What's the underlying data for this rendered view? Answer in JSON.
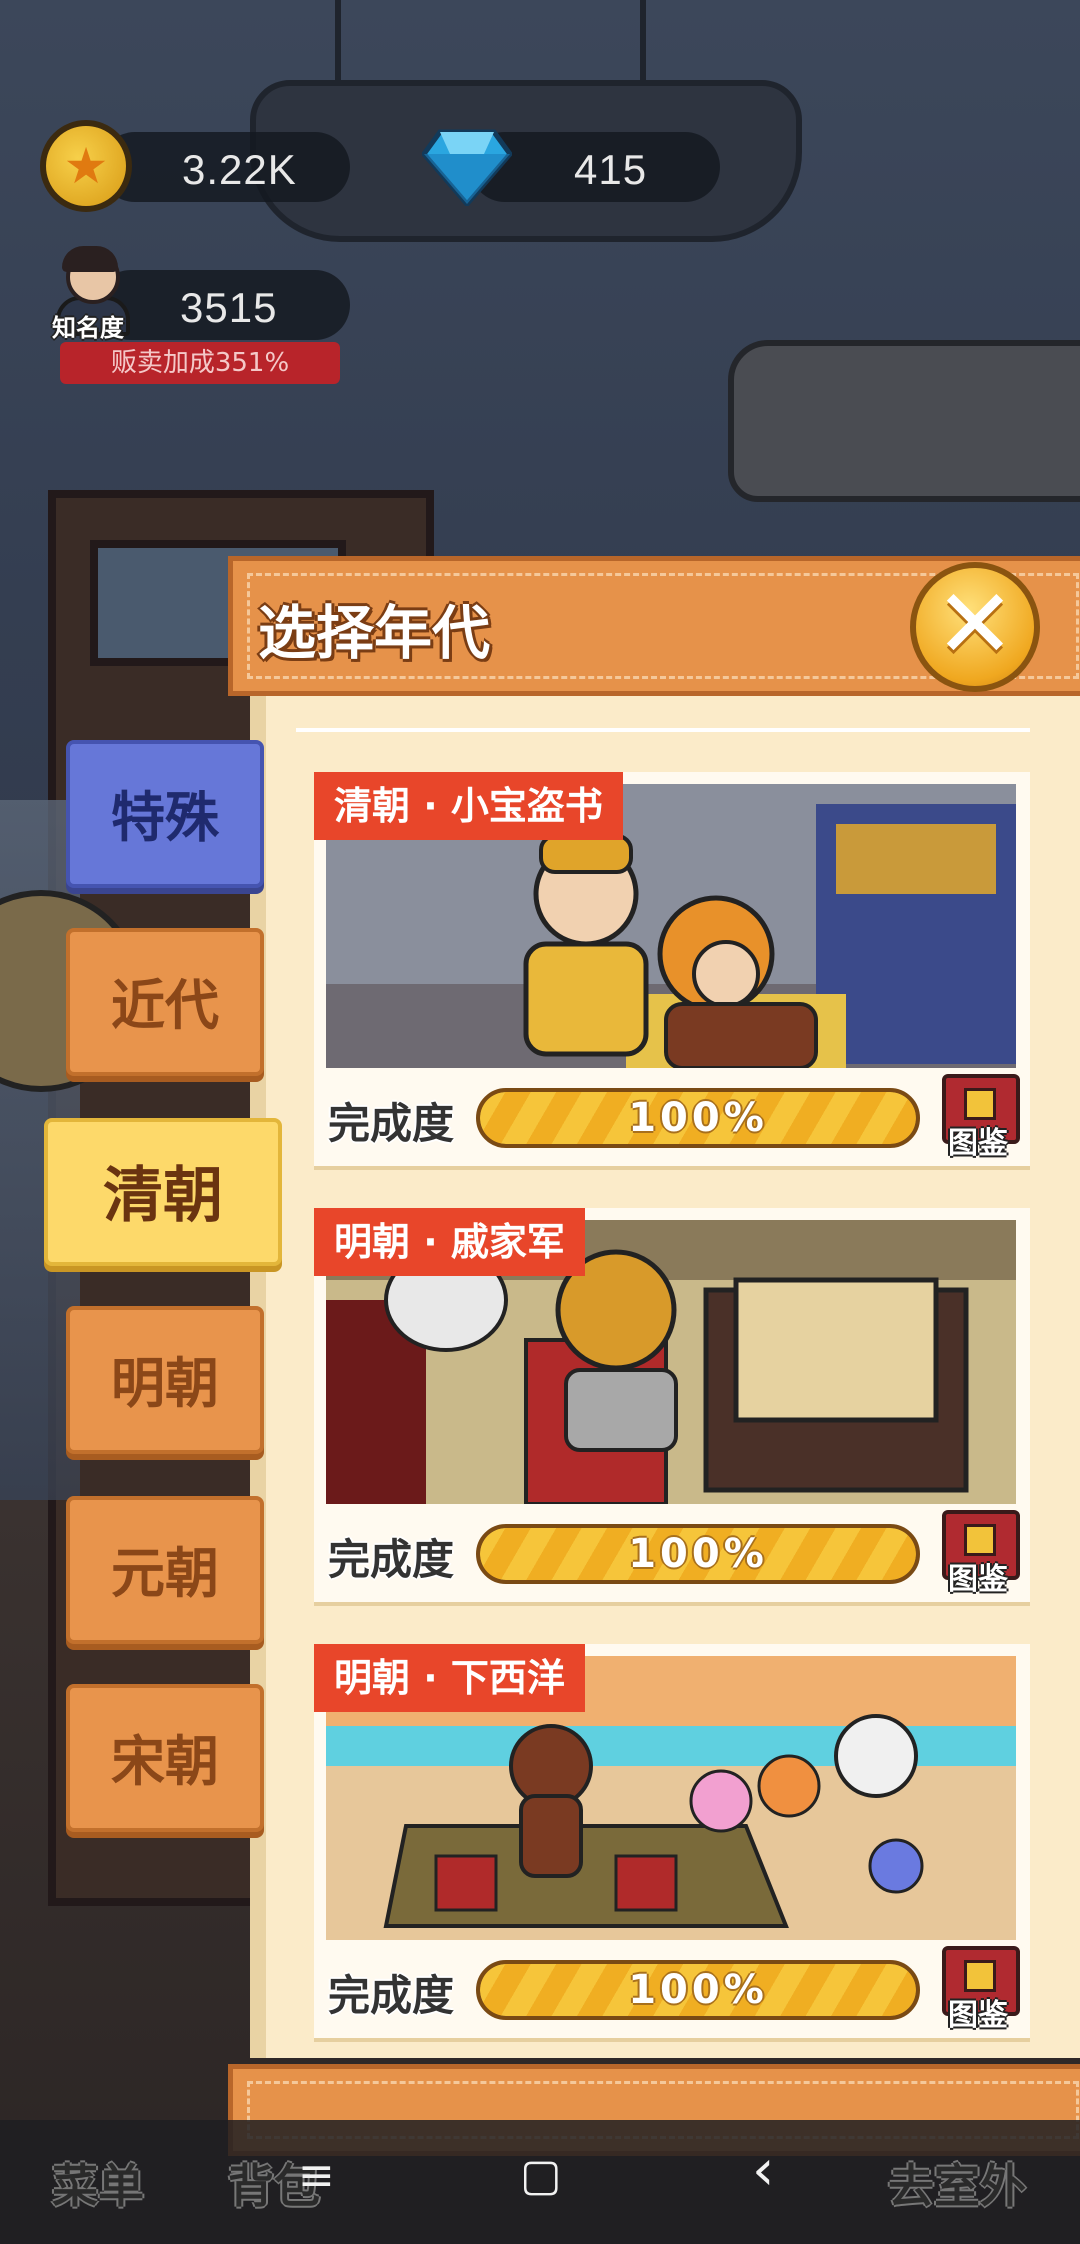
{
  "hud": {
    "coins": "3.22K",
    "gems": "415",
    "fame_value": "3515",
    "fame_label": "知名度",
    "sales_bonus": "贩卖加成351%"
  },
  "modal": {
    "title": "选择年代",
    "close_icon": "close-x-icon"
  },
  "tabs": [
    {
      "label": "特殊",
      "state": "blue"
    },
    {
      "label": "近代",
      "state": "normal"
    },
    {
      "label": "清朝",
      "state": "active"
    },
    {
      "label": "明朝",
      "state": "normal"
    },
    {
      "label": "元朝",
      "state": "normal"
    },
    {
      "label": "宋朝",
      "state": "normal"
    }
  ],
  "cards": [
    {
      "tag": "清朝 · 小宝盗书",
      "progress_label": "完成度",
      "progress_text": "100%",
      "progress": 1.0,
      "book_label": "图鉴"
    },
    {
      "tag": "明朝 · 戚家军",
      "progress_label": "完成度",
      "progress_text": "100%",
      "progress": 1.0,
      "book_label": "图鉴"
    },
    {
      "tag": "明朝 · 下西洋",
      "progress_label": "完成度",
      "progress_text": "100%",
      "progress": 1.0,
      "book_label": "图鉴"
    }
  ],
  "game_nav": {
    "menu": "菜单",
    "bag": "背包",
    "go_outside": "去室外"
  },
  "system_nav": {
    "recents_icon": "≡",
    "home_icon": "▢",
    "back_icon": "‹"
  },
  "colors": {
    "accent_orange": "#e6924a",
    "active_tab": "#fdd96a",
    "special_tab": "#6677d8",
    "tag_red": "#e8462a",
    "progress_yellow": "#f6c53a"
  }
}
